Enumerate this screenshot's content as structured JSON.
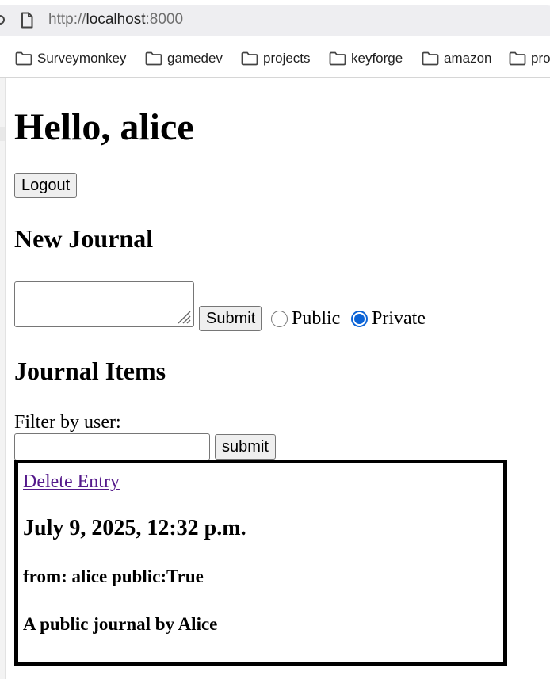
{
  "browser": {
    "url_scheme": "http://",
    "url_host": "localhost",
    "url_port": ":8000",
    "bookmarks": [
      {
        "label": "Surveymonkey",
        "icon": "folder-icon"
      },
      {
        "label": "gamedev",
        "icon": "folder-icon"
      },
      {
        "label": "projects",
        "icon": "folder-icon"
      },
      {
        "label": "keyforge",
        "icon": "folder-icon"
      },
      {
        "label": "amazon",
        "icon": "folder-icon"
      },
      {
        "label": "pro",
        "icon": "folder-icon"
      }
    ]
  },
  "page": {
    "greeting": "Hello, alice",
    "logout_label": "Logout",
    "new_journal_heading": "New Journal",
    "journal_textarea_value": "",
    "submit_label": "Submit",
    "visibility_options": [
      {
        "label": "Public",
        "checked": false
      },
      {
        "label": "Private",
        "checked": true
      }
    ],
    "journal_items_heading": "Journal Items",
    "filter_label": "Filter by user:",
    "filter_input_value": "",
    "filter_submit_label": "submit",
    "entries": [
      {
        "delete_label": "Delete Entry",
        "date": "July 9, 2025, 12:32 p.m.",
        "meta": "from: alice public:True",
        "text": "A public journal by Alice"
      }
    ]
  },
  "colors": {
    "link": "#551a8b",
    "radio_accent": "#0b63d6",
    "address_bar_bg": "#eeeef1"
  }
}
